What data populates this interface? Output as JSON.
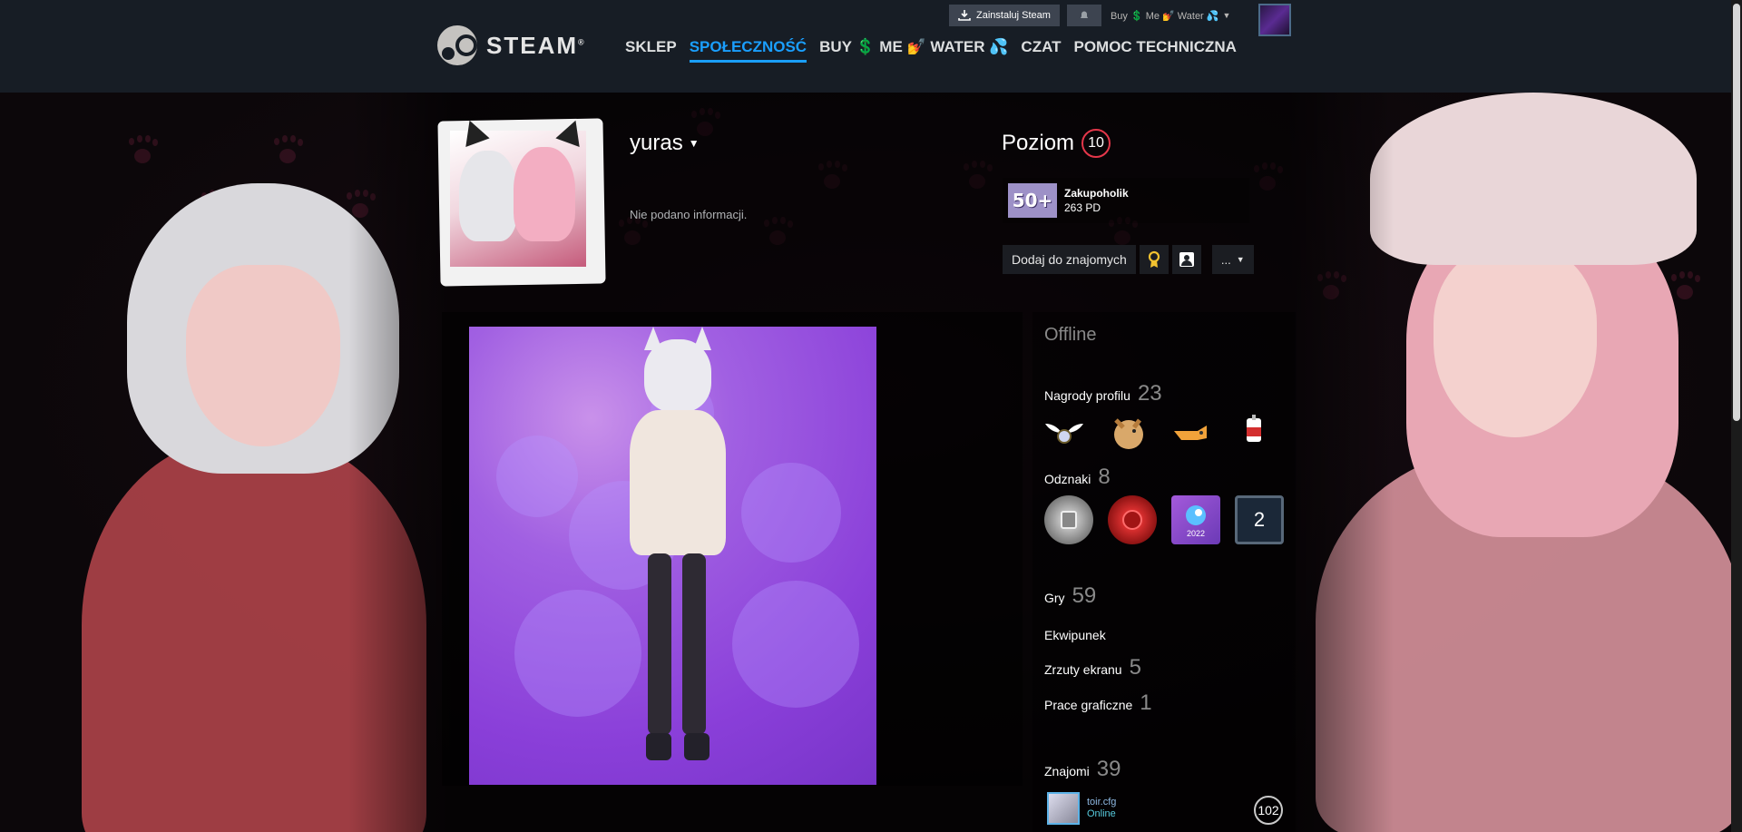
{
  "header": {
    "logo_text": "STEAM",
    "logo_mark": "®",
    "nav": [
      {
        "label": "SKLEP"
      },
      {
        "label": "SPOŁECZNOŚĆ",
        "active": true
      },
      {
        "label": "BUY 💲 ME 💅 WATER 💦"
      },
      {
        "label": "CZAT"
      },
      {
        "label": "POMOC TECHNICZNA"
      }
    ],
    "install_label": "Zainstaluj Steam",
    "account_name": "Buy 💲 Me 💅 Water 💦"
  },
  "profile": {
    "persona_name": "yuras",
    "summary": "Nie podano informacji.",
    "level_label": "Poziom",
    "level": "10",
    "badge": {
      "icon_text": "50+",
      "title": "Zakupoholik",
      "xp": "263 PD"
    },
    "add_friend_label": "Dodaj do znajomych",
    "more_label": "..."
  },
  "sidebar": {
    "status": "Offline",
    "awards_label": "Nagrody profilu",
    "awards_count": "23",
    "award_icons": [
      "wings-award-icon",
      "dog-award-icon",
      "hand-award-icon",
      "cup-award-icon"
    ],
    "badges_label": "Odznaki",
    "badges_count": "8",
    "badge_tiles": [
      "silver-badge-icon",
      "red-seal-badge-icon",
      "steam-2022-badge-icon",
      "level-2-badge-icon"
    ],
    "badge_2022_label": "2022",
    "badge_level_label": "2",
    "games_label": "Gry",
    "games_count": "59",
    "inventory_label": "Ekwipunek",
    "screenshots_label": "Zrzuty ekranu",
    "screenshots_count": "5",
    "artwork_label": "Prace graficzne",
    "artwork_count": "1",
    "friends_label": "Znajomi",
    "friends_count": "39",
    "friend": {
      "name": "toir.cfg",
      "status": "Online",
      "level": "102"
    }
  },
  "colors": {
    "header_bg": "#171d25",
    "accent": "#1a9fff",
    "level_ring": "#e4374a",
    "online": "#57cbde"
  }
}
